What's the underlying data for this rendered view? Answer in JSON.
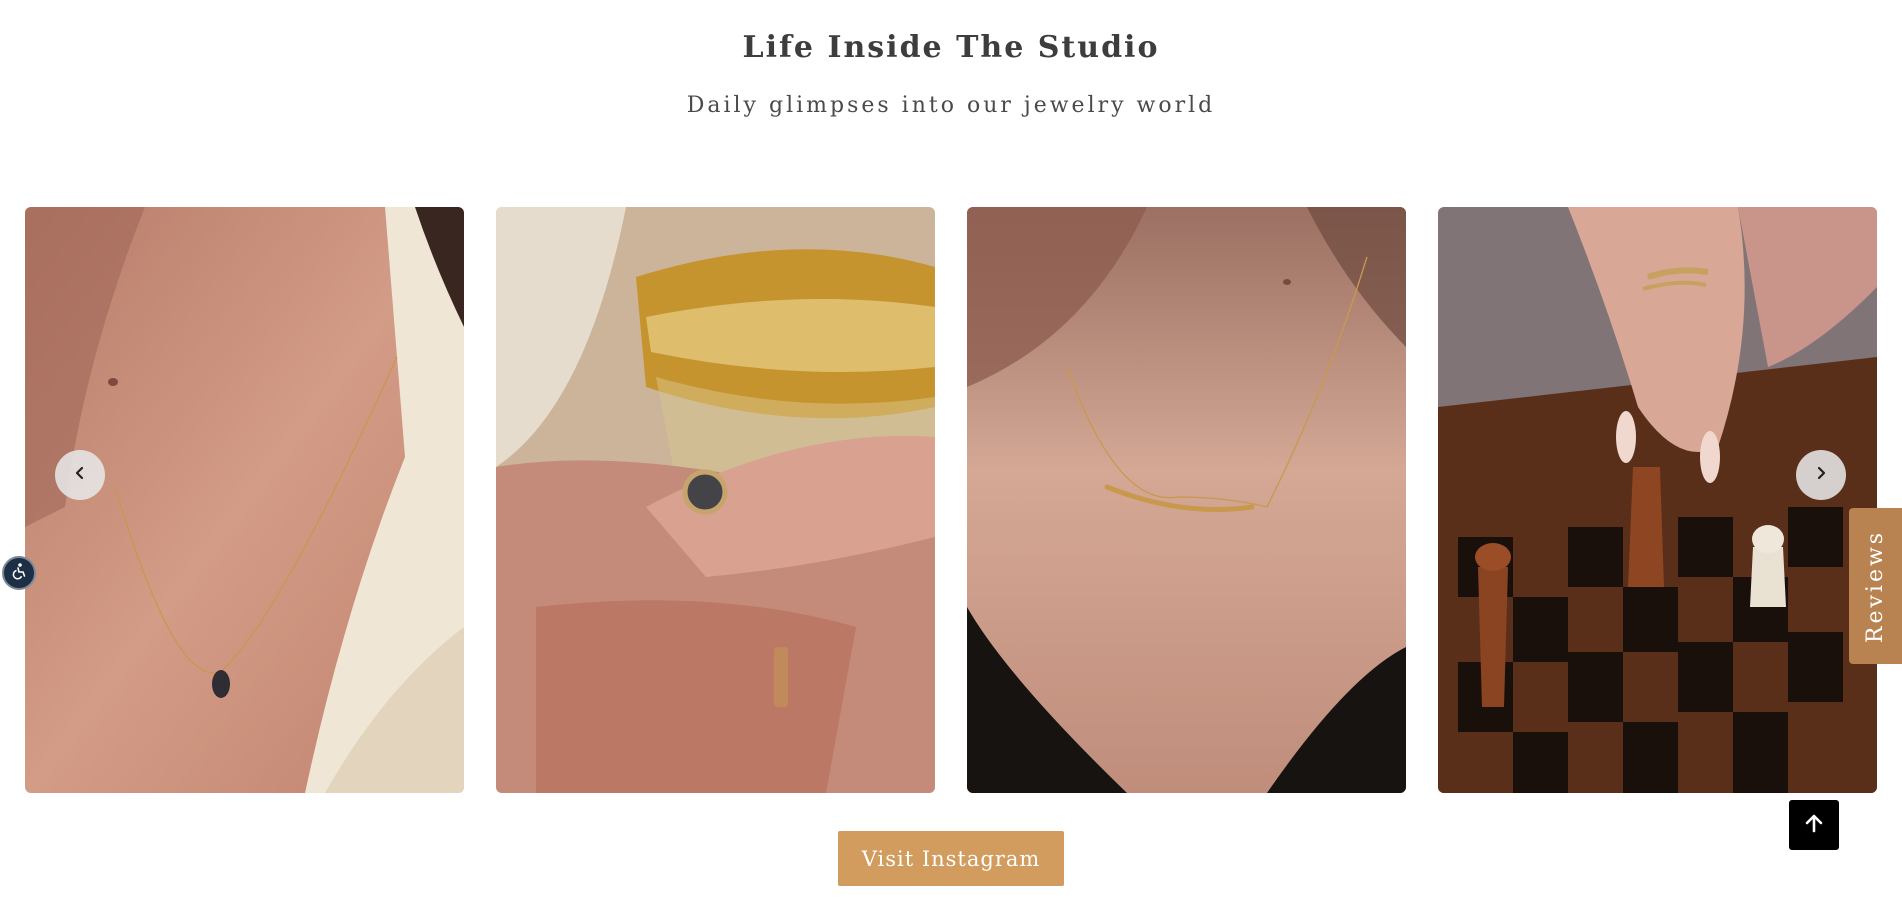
{
  "section": {
    "title": "Life Inside The Studio",
    "subtitle": "Daily glimpses into our jewelry world"
  },
  "gallery": {
    "items": [
      {
        "icon": "necklace-pendant-photo"
      },
      {
        "icon": "ring-glass-photo"
      },
      {
        "icon": "necklace-bar-photo"
      },
      {
        "icon": "ring-chess-photo"
      }
    ],
    "prev_icon": "chevron-left-icon",
    "next_icon": "chevron-right-icon"
  },
  "cta": {
    "label": "Visit Instagram"
  },
  "reviews_tab": {
    "label": "Reviews"
  },
  "widgets": {
    "back_to_top_icon": "arrow-up-icon",
    "accessibility_icon": "accessibility-icon"
  },
  "colors": {
    "accent": "#d29c5e",
    "reviews_tab": "#b88350",
    "heading": "#3d3d3d"
  }
}
